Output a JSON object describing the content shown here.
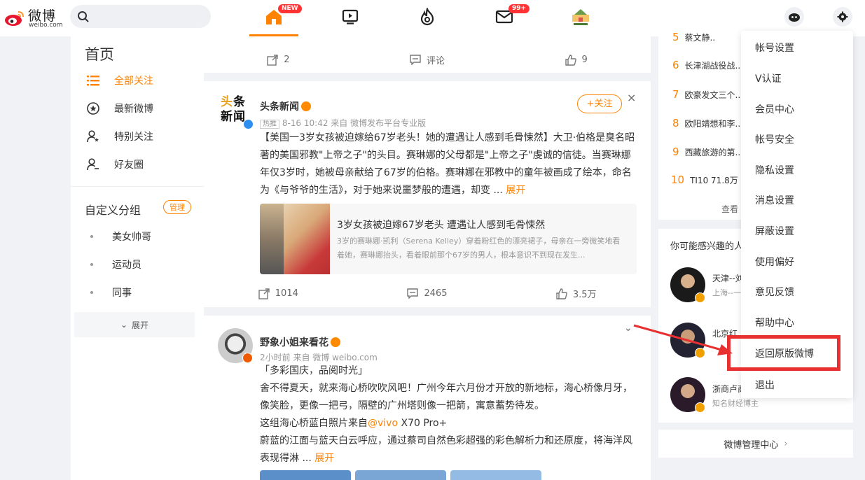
{
  "header": {
    "logo_text": "微博",
    "logo_domain": "weibo.com",
    "search_placeholder": "",
    "nav": {
      "home_badge": "NEW",
      "messages_badge": "99+"
    }
  },
  "left": {
    "title": "首页",
    "nav": [
      {
        "label": "全部关注",
        "active": true
      },
      {
        "label": "最新微博"
      },
      {
        "label": "特别关注"
      },
      {
        "label": "好友圈"
      }
    ],
    "group_title": "自定义分组",
    "manage_label": "管理",
    "groups": [
      "美女帅哥",
      "运动员",
      "同事"
    ],
    "expand_label": "展开"
  },
  "feed": {
    "top_actions": {
      "repost": "2",
      "comment": "评论",
      "like": "9"
    },
    "post1": {
      "avatar_text": "头条新闻",
      "username": "头条新闻",
      "follow_label": "+关注",
      "tag": "热推",
      "meta": "8-16 10:42  来自 微博发布平台专业版",
      "text": "【美国一3岁女孩被迫嫁给67岁老头！她的遭遇让人感到毛骨悚然】大卫·伯格是臭名昭著的美国邪教\"上帝之子\"的头目。赛琳娜的父母都是\"上帝之子\"虔诚的信徒。当赛琳娜年仅3岁时，她被母亲献给了67岁的伯格。赛琳娜在邪教中的童年被画成了绘本，命名为《与爷爷的生活》，对于她来说噩梦般的遭遇，却变 ...",
      "expand": "展开",
      "article_title": "3岁女孩被迫嫁67岁老头 遭遇让人感到毛骨悚然",
      "article_desc": "3岁的赛琳娜·凯利（Serena Kelley）穿着粉红色的漂亮裙子，母亲在一旁微笑地看着她，赛琳娜抬头，看着眼前那个67岁的男人，根本意识不到现在发生...",
      "actions": {
        "repost": "1014",
        "comment": "2465",
        "like": "3.5万"
      }
    },
    "post2": {
      "username": "野象小姐来看花",
      "meta": "2小时前  来自 微博 weibo.com",
      "lines": [
        "「多彩国庆，品阅时光」",
        "舍不得夏天，就来海心桥吹吹风吧！广州今年六月份才开放的新地标，海心桥像月牙，",
        "像笑脸，更像一把弓，隔壁的广州塔则像一把箭，寓意蓄势待发。"
      ],
      "line4_prefix": "这组海心桥蓝白照片来自",
      "line4_mention": "@vivo",
      "line4_suffix": " X70 Pro+",
      "line5": "蔚蓝的江面与蓝天白云呼应，通过蔡司自然色彩超强的彩色解析力和还原度，将海洋风",
      "line6": "表现得淋 ...",
      "expand": "展开"
    }
  },
  "right": {
    "hot": [
      {
        "rank": "5",
        "text": "蔡文静.."
      },
      {
        "rank": "6",
        "text": "长津湖战役战..."
      },
      {
        "rank": "7",
        "text": "欧豪发文三个..."
      },
      {
        "rank": "8",
        "text": "欧阳靖想和李..."
      },
      {
        "rank": "9",
        "text": "西藏旅游的第..."
      },
      {
        "rank": "10",
        "text": "TI10  71.8万"
      }
    ],
    "see_more": "查看",
    "interest_title": "你可能感兴趣的人",
    "people": [
      {
        "name": "天津--刘",
        "desc": "上海--一"
      },
      {
        "name": "北京红",
        "desc": ""
      },
      {
        "name": "浙商卢商",
        "desc": "知名财经博主"
      }
    ],
    "manage_center": "微博管理中心"
  },
  "dropdown": {
    "items": [
      "帐号设置",
      "V认证",
      "会员中心",
      "帐号安全",
      "隐私设置",
      "消息设置",
      "屏蔽设置",
      "使用偏好",
      "意见反馈",
      "帮助中心",
      "返回原版微博",
      "退出"
    ]
  },
  "colors": {
    "accent": "#ff8200",
    "highlight": "#e83030"
  }
}
